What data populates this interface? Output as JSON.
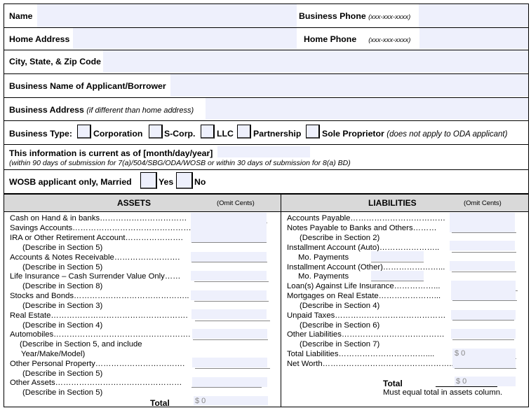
{
  "header_fields": {
    "name_label": "Name",
    "business_phone_label": "Business Phone",
    "business_phone_hint": "(xxx-xxx-xxxx)",
    "home_address_label": "Home Address",
    "home_phone_label": "Home Phone",
    "home_phone_hint": "(xxx-xxx-xxxx)",
    "city_state_zip_label": "City, State, & Zip Code",
    "business_name_label": "Business Name of Applicant/Borrower",
    "business_address_label": "Business Address",
    "business_address_hint": "(if different than home address)"
  },
  "business_type": {
    "label": "Business Type:",
    "options": [
      "Corporation",
      "S-Corp.",
      "LLC",
      "Partnership",
      "Sole Proprietor"
    ],
    "note": "(does not apply to ODA applicant)"
  },
  "current_as_of": {
    "label": "This information is current as of [month/day/year]",
    "note": "(within 90 days of submission for 7(a)/504/SBG/ODA/WOSB or within 30 days of submission for 8(a) BD)"
  },
  "wosb": {
    "label": "WOSB applicant only, Married",
    "yes": "Yes",
    "no": "No"
  },
  "assets": {
    "title": "ASSETS",
    "omit": "(Omit Cents)",
    "rows": [
      {
        "label": "Cash on Hand & in banks……………………………",
        "sub": ""
      },
      {
        "label": "Savings Accounts………………………………………",
        "sub": ""
      },
      {
        "label": "IRA or Other Retirement Account………………….",
        "sub": "(Describe in Section 5)"
      },
      {
        "label": "Accounts & Notes Receivable…………………….",
        "sub": "(Describe in Section 5)"
      },
      {
        "label": "Life Insurance – Cash Surrender Value Only……",
        "sub": "(Describe in Section 8)"
      },
      {
        "label": "Stocks and Bonds……………………………………..",
        "sub": "(Describe in Section 3)"
      },
      {
        "label": "Real Estate…………………………………………….",
        "sub": "(Describe in Section 4)"
      },
      {
        "label": "Automobiles…………………………………………….",
        "sub": "(Describe in Section 5, and include"
      },
      {
        "label": "",
        "sub": " Year/Make/Model)"
      },
      {
        "label": "Other Personal Property…………………………….",
        "sub": "(Describe in Section 5)"
      },
      {
        "label": "Other Assets…………………………………………",
        "sub": "(Describe in Section 5)"
      }
    ],
    "total_label": "Total",
    "total_value": "$ 0"
  },
  "liabilities": {
    "title": "LIABILITIES",
    "omit": "(Omit Cents)",
    "accounts_payable": "Accounts Payable………………………………",
    "notes_payable": "Notes Payable to Banks and Others………",
    "notes_payable_sub": "(Describe in Section 2)",
    "installment_auto": "Installment Account (Auto)…………………..",
    "mo_payments_1": "Mo. Payments",
    "installment_other": "Installment Account (Other)…………………...",
    "mo_payments_2": "Mo. Payments",
    "loans_life": "Loan(s) Against Life Insurance……………...",
    "mortgages": "Mortgages on Real Estate…………………...",
    "mortgages_sub": "(Describe in Section 4)",
    "unpaid_taxes": "Unpaid Taxes……………………………………",
    "unpaid_taxes_sub": "(Describe in Section 6)",
    "other_liabilities": "Other Liabilities…………………………………",
    "other_liabilities_sub": "(Describe in Section 7)",
    "total_liabilities": "Total Liabilities……………………………....",
    "total_liabilities_value": "$ 0",
    "net_worth": "Net Worth…………………………………………..",
    "total_label": "Total",
    "total_value": "$ 0",
    "must_equal": "Must equal total in assets column."
  }
}
